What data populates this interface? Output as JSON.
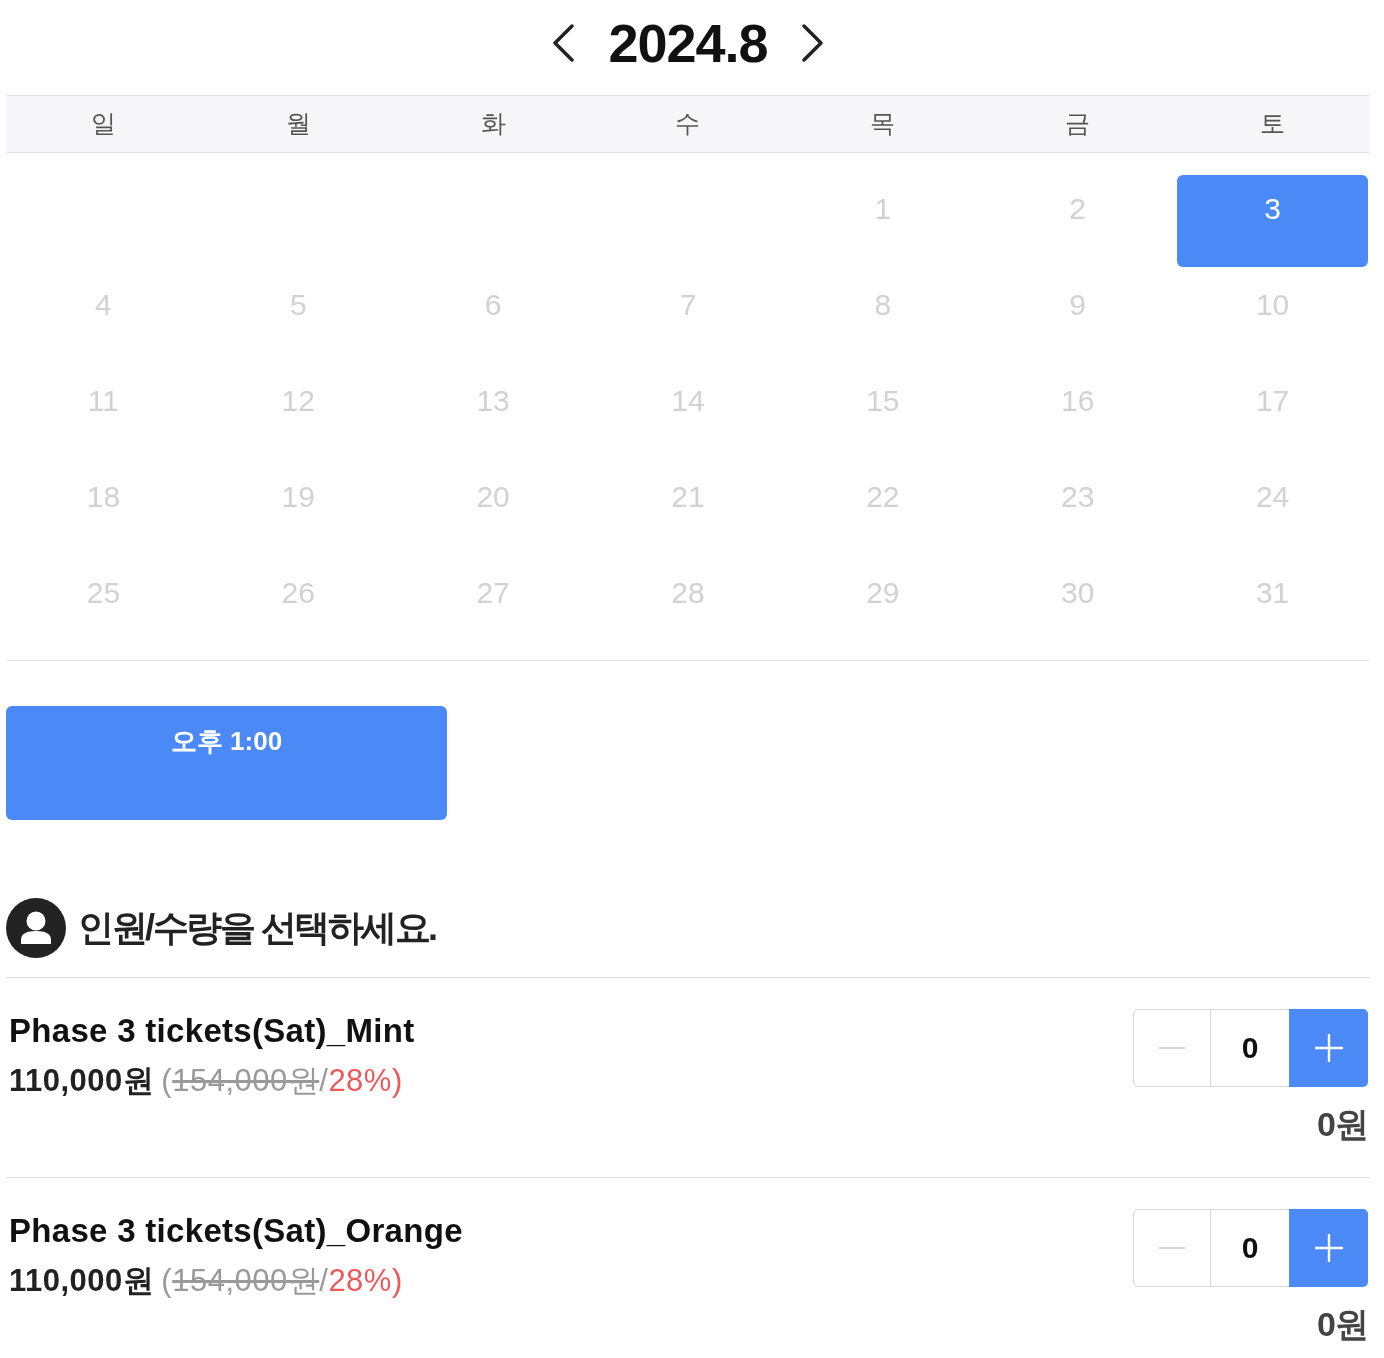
{
  "calendar": {
    "title": "2024.8",
    "weekdays": [
      "일",
      "월",
      "화",
      "수",
      "목",
      "금",
      "토"
    ],
    "weeks": [
      [
        {
          "day": "1",
          "disabled": true,
          "selected": false
        },
        {
          "day": "2",
          "disabled": true,
          "selected": false
        },
        {
          "day": "3",
          "disabled": false,
          "selected": true
        }
      ],
      [
        {
          "day": "4",
          "disabled": true,
          "selected": false
        },
        {
          "day": "5",
          "disabled": true,
          "selected": false
        },
        {
          "day": "6",
          "disabled": true,
          "selected": false
        },
        {
          "day": "7",
          "disabled": true,
          "selected": false
        },
        {
          "day": "8",
          "disabled": true,
          "selected": false
        },
        {
          "day": "9",
          "disabled": true,
          "selected": false
        },
        {
          "day": "10",
          "disabled": true,
          "selected": false
        }
      ],
      [
        {
          "day": "11",
          "disabled": true,
          "selected": false
        },
        {
          "day": "12",
          "disabled": true,
          "selected": false
        },
        {
          "day": "13",
          "disabled": true,
          "selected": false
        },
        {
          "day": "14",
          "disabled": true,
          "selected": false
        },
        {
          "day": "15",
          "disabled": true,
          "selected": false
        },
        {
          "day": "16",
          "disabled": true,
          "selected": false
        },
        {
          "day": "17",
          "disabled": true,
          "selected": false
        }
      ],
      [
        {
          "day": "18",
          "disabled": true,
          "selected": false
        },
        {
          "day": "19",
          "disabled": true,
          "selected": false
        },
        {
          "day": "20",
          "disabled": true,
          "selected": false
        },
        {
          "day": "21",
          "disabled": true,
          "selected": false
        },
        {
          "day": "22",
          "disabled": true,
          "selected": false
        },
        {
          "day": "23",
          "disabled": true,
          "selected": false
        },
        {
          "day": "24",
          "disabled": true,
          "selected": false
        }
      ],
      [
        {
          "day": "25",
          "disabled": true,
          "selected": false
        },
        {
          "day": "26",
          "disabled": true,
          "selected": false
        },
        {
          "day": "27",
          "disabled": true,
          "selected": false
        },
        {
          "day": "28",
          "disabled": true,
          "selected": false
        },
        {
          "day": "29",
          "disabled": true,
          "selected": false
        },
        {
          "day": "30",
          "disabled": true,
          "selected": false
        },
        {
          "day": "31",
          "disabled": true,
          "selected": false
        }
      ]
    ]
  },
  "times": [
    {
      "label": "오후 1:00",
      "selected": true
    }
  ],
  "quantity_section": {
    "heading": "인원/수량을 선택하세요.",
    "products": [
      {
        "name": "Phase 3 tickets(Sat)_Mint",
        "price": "110,000원",
        "note_parts": [
          {
            "kind": "plain",
            "text": "("
          },
          {
            "kind": "struck",
            "text": "154,000원"
          },
          {
            "kind": "plain",
            "text": "/"
          },
          {
            "kind": "discount",
            "text": "28%)"
          }
        ],
        "quantity": "0",
        "decrement_disabled": true,
        "total": "0원"
      },
      {
        "name": "Phase 3 tickets(Sat)_Orange",
        "price": "110,000원",
        "note_parts": [
          {
            "kind": "plain",
            "text": "("
          },
          {
            "kind": "struck",
            "text": "154,000원"
          },
          {
            "kind": "plain",
            "text": "/"
          },
          {
            "kind": "discount",
            "text": "28%)"
          }
        ],
        "quantity": "0",
        "decrement_disabled": true,
        "total": "0원"
      }
    ]
  }
}
